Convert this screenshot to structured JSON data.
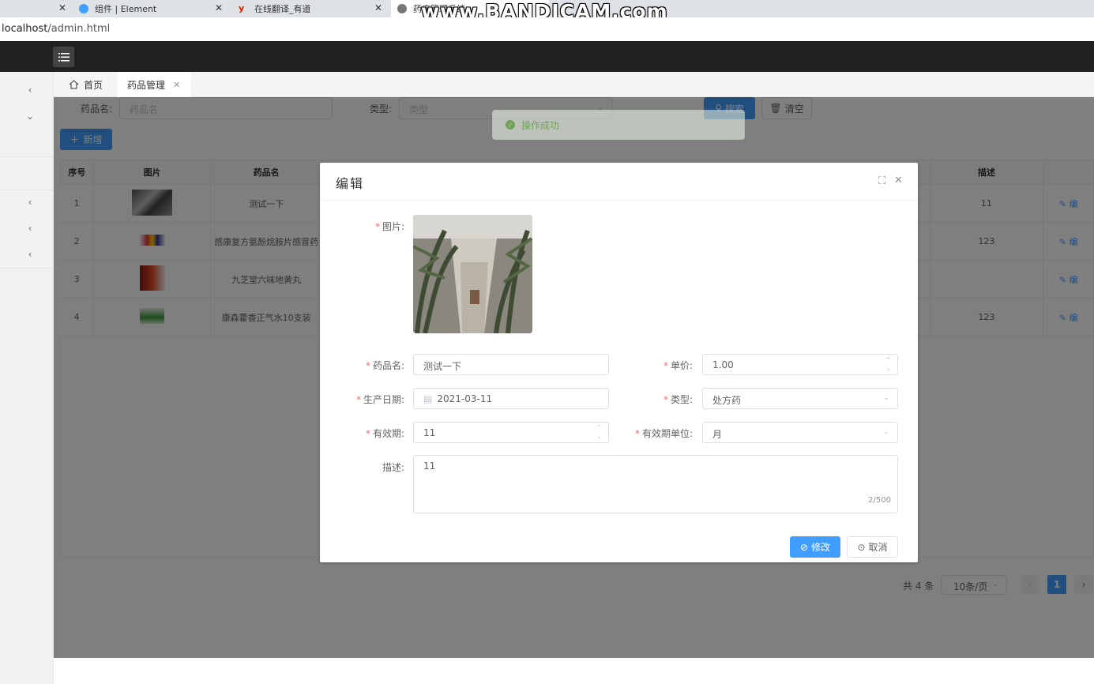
{
  "browser": {
    "tabs": [
      {
        "title": "组件 | Element",
        "active": false
      },
      {
        "title": "在线翻译_有道",
        "active": false
      },
      {
        "title": "药店管理系统",
        "active": true
      }
    ],
    "url_host": "localhost",
    "url_path": "/admin.html",
    "watermark": "www.BANDICAM.com"
  },
  "app_tabs": [
    {
      "label": "首页",
      "icon": "home-icon"
    },
    {
      "label": "药品管理",
      "icon": "close-icon"
    }
  ],
  "search": {
    "name_label": "药品名:",
    "name_placeholder": "药品名",
    "type_label": "类型:",
    "type_placeholder": "类型",
    "search_button": "搜索",
    "clear_button": "清空"
  },
  "add_button": "新增",
  "table": {
    "headers": [
      "序号",
      "图片",
      "药品名",
      "描述"
    ],
    "rows": [
      {
        "index": "1",
        "name": "测试一下",
        "desc": "11",
        "action": "编"
      },
      {
        "index": "2",
        "name": "感康复方氨酚烷胺片感冒药",
        "desc": "123",
        "action": "编"
      },
      {
        "index": "3",
        "name": "九芝堂六味地黄丸",
        "desc": "",
        "action": "编"
      },
      {
        "index": "4",
        "name": "康森藿香正气水10支装",
        "desc": "123",
        "action": "编"
      }
    ]
  },
  "pagination": {
    "total_text": "共 4 条",
    "page_size": "10条/页",
    "current_page": "1"
  },
  "toast": {
    "message": "操作成功",
    "color": "#67c23a"
  },
  "dialog": {
    "title": "编辑",
    "fields": {
      "image_label": "图片:",
      "name_label": "药品名:",
      "name_value": "测试一下",
      "price_label": "单价:",
      "price_value": "1.00",
      "date_label": "生产日期:",
      "date_value": "2021-03-11",
      "type_label": "类型:",
      "type_value": "处方药",
      "validity_label": "有效期:",
      "validity_value": "11",
      "validity_unit_label": "有效期单位:",
      "validity_unit_value": "月",
      "desc_label": "描述:",
      "desc_value": "11",
      "desc_counter": "2/500"
    },
    "submit_button": "修改",
    "cancel_button": "取消"
  },
  "colors": {
    "primary": "#409eff",
    "header": "#212121",
    "required": "#f56c6c"
  }
}
